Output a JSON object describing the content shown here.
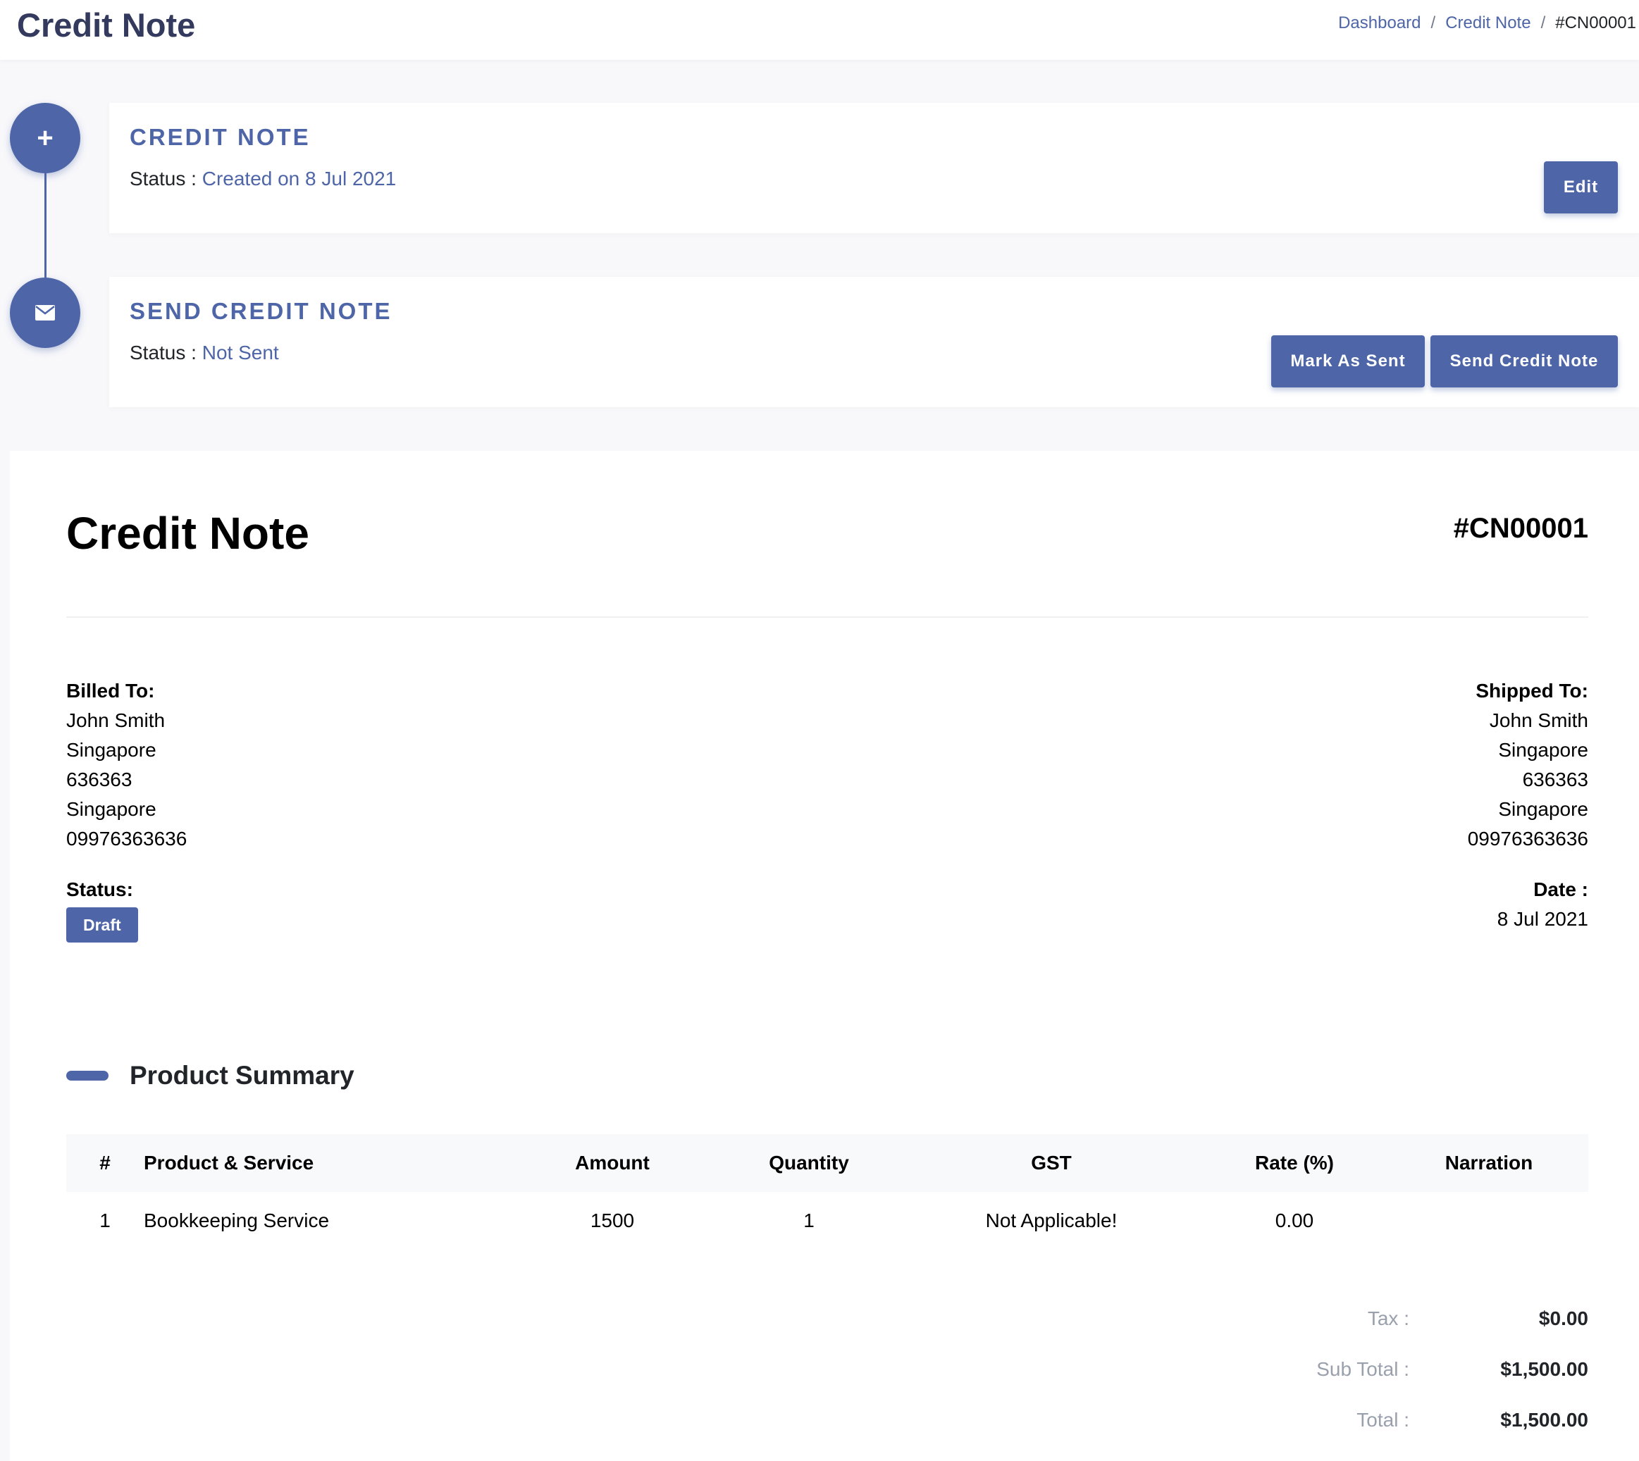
{
  "header": {
    "title": "Credit Note",
    "breadcrumb": {
      "dashboard": "Dashboard",
      "credit_note": "Credit Note",
      "current": "#CN00001",
      "separator": "/"
    }
  },
  "steps": {
    "create": {
      "icon": "plus-icon",
      "title": "CREDIT NOTE",
      "status_label": "Status :",
      "status_value": "Created on 8 Jul 2021",
      "edit_label": "Edit"
    },
    "send": {
      "icon": "envelope-icon",
      "title": "SEND CREDIT NOTE",
      "status_label": "Status :",
      "status_value": "Not Sent",
      "mark_sent_label": "Mark As Sent",
      "send_label": "Send Credit Note"
    }
  },
  "invoice": {
    "title": "Credit Note",
    "number": "#CN00001",
    "billed_to": {
      "heading": "Billed To:",
      "lines": [
        "John Smith",
        "Singapore",
        "636363",
        "Singapore",
        "09976363636"
      ]
    },
    "shipped_to": {
      "heading": "Shipped To:",
      "lines": [
        "John Smith",
        "Singapore",
        "636363",
        "Singapore",
        "09976363636"
      ]
    },
    "status": {
      "heading": "Status:",
      "value": "Draft"
    },
    "date": {
      "heading": "Date :",
      "value": "8 Jul 2021"
    },
    "summary_title": "Product Summary",
    "columns": [
      "#",
      "Product & Service",
      "Amount",
      "Quantity",
      "GST",
      "Rate (%)",
      "Narration"
    ],
    "rows": [
      [
        "1",
        "Bookkeeping Service",
        "1500",
        "1",
        "Not Applicable!",
        "0.00",
        ""
      ]
    ],
    "totals": {
      "tax_label": "Tax :",
      "tax_value": "$0.00",
      "subtotal_label": "Sub Total :",
      "subtotal_value": "$1,500.00",
      "total_label": "Total :",
      "total_value": "$1,500.00"
    }
  },
  "colors": {
    "accent": "#4e66a8",
    "title": "#343a5e",
    "background": "#f8f8fb"
  }
}
